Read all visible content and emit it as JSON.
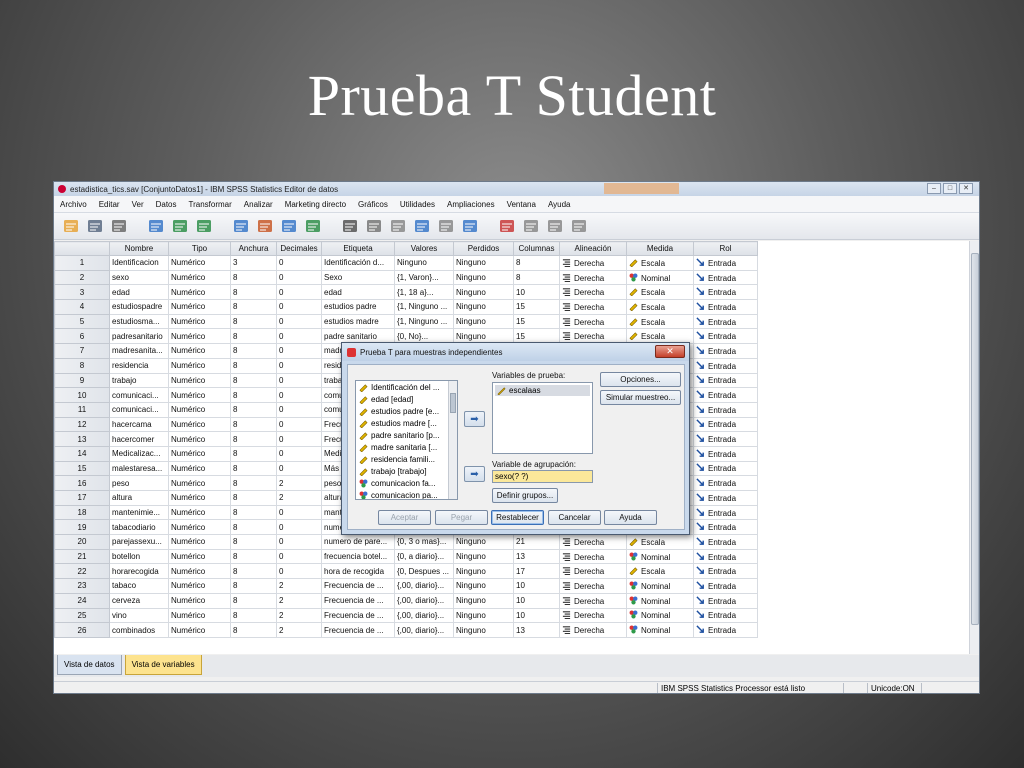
{
  "slide": {
    "title": "Prueba T Student"
  },
  "window": {
    "title": "estadistica_tics.sav [ConjuntoDatos1] - IBM SPSS Statistics Editor de datos",
    "controls": [
      "–",
      "□",
      "✕"
    ]
  },
  "menu": [
    "Archivo",
    "Editar",
    "Ver",
    "Datos",
    "Transformar",
    "Analizar",
    "Marketing directo",
    "Gráficos",
    "Utilidades",
    "Ampliaciones",
    "Ventana",
    "Ayuda"
  ],
  "toolbar_icons": [
    "open-icon",
    "save-icon",
    "print-icon",
    "dialog-recall-icon",
    "undo-icon",
    "redo-icon",
    "goto-case-icon",
    "goto-variable-icon",
    "variables-icon",
    "run-descriptives-icon",
    "find-icon",
    "insert-cases-icon",
    "insert-variable-icon",
    "split-file-icon",
    "weight-cases-icon",
    "select-cases-icon",
    "value-labels-icon",
    "use-sets-icon",
    "show-sets-icon",
    "spell-check-icon"
  ],
  "grid": {
    "columns": [
      "",
      "Nombre",
      "Tipo",
      "Anchura",
      "Decimales",
      "Etiqueta",
      "Valores",
      "Perdidos",
      "Columnas",
      "Alineación",
      "Medida",
      "Rol"
    ],
    "rows": [
      [
        "1",
        "Identificacion",
        "Numérico",
        "3",
        "0",
        "Identificación d...",
        "Ninguno",
        "Ninguno",
        "8",
        "Derecha",
        "Escala",
        "Entrada"
      ],
      [
        "2",
        "sexo",
        "Numérico",
        "8",
        "0",
        "Sexo",
        "{1, Varon}...",
        "Ninguno",
        "8",
        "Derecha",
        "Nominal",
        "Entrada"
      ],
      [
        "3",
        "edad",
        "Numérico",
        "8",
        "0",
        "edad",
        "{1, 18 a}...",
        "Ninguno",
        "10",
        "Derecha",
        "Escala",
        "Entrada"
      ],
      [
        "4",
        "estudiospadre",
        "Numérico",
        "8",
        "0",
        "estudios padre",
        "{1, Ninguno ...",
        "Ninguno",
        "15",
        "Derecha",
        "Escala",
        "Entrada"
      ],
      [
        "5",
        "estudiosma...",
        "Numérico",
        "8",
        "0",
        "estudios madre",
        "{1, Ninguno ...",
        "Ninguno",
        "15",
        "Derecha",
        "Escala",
        "Entrada"
      ],
      [
        "6",
        "padresanitario",
        "Numérico",
        "8",
        "0",
        "padre sanitario",
        "{0, No}...",
        "Ninguno",
        "15",
        "Derecha",
        "Escala",
        "Entrada"
      ],
      [
        "7",
        "madresanita...",
        "Numérico",
        "8",
        "0",
        "madr",
        "",
        "",
        "",
        "",
        "",
        "Entrada"
      ],
      [
        "8",
        "residencia",
        "Numérico",
        "8",
        "0",
        "resid",
        "",
        "",
        "",
        "",
        "",
        "Entrada"
      ],
      [
        "9",
        "trabajo",
        "Numérico",
        "8",
        "0",
        "traba",
        "",
        "",
        "",
        "",
        "",
        "Entrada"
      ],
      [
        "10",
        "comunicaci...",
        "Numérico",
        "8",
        "0",
        "comu",
        "",
        "",
        "",
        "",
        "",
        "Entrada"
      ],
      [
        "11",
        "comunicaci...",
        "Numérico",
        "8",
        "0",
        "comu",
        "",
        "",
        "",
        "",
        "",
        "Entrada"
      ],
      [
        "12",
        "hacercama",
        "Numérico",
        "8",
        "0",
        "Frecu",
        "",
        "",
        "",
        "",
        "",
        "Entrada"
      ],
      [
        "13",
        "hacercomer",
        "Numérico",
        "8",
        "0",
        "Frecu",
        "",
        "",
        "",
        "",
        "",
        "Entrada"
      ],
      [
        "14",
        "Medicalizac...",
        "Numérico",
        "8",
        "0",
        "Medic",
        "",
        "",
        "",
        "",
        "",
        "Entrada"
      ],
      [
        "15",
        "malestaresa...",
        "Numérico",
        "8",
        "0",
        "Más",
        "",
        "",
        "",
        "",
        "",
        "Entrada"
      ],
      [
        "16",
        "peso",
        "Numérico",
        "8",
        "2",
        "peso",
        "",
        "",
        "",
        "",
        "",
        "Entrada"
      ],
      [
        "17",
        "altura",
        "Numérico",
        "8",
        "2",
        "altura",
        "",
        "",
        "",
        "",
        "",
        "Entrada"
      ],
      [
        "18",
        "mantenimie...",
        "Numérico",
        "8",
        "0",
        "mant",
        "",
        "",
        "",
        "",
        "",
        "Entrada"
      ],
      [
        "19",
        "tabacodiario",
        "Numérico",
        "8",
        "0",
        "nume",
        "",
        "",
        "",
        "",
        "",
        "Entrada"
      ],
      [
        "20",
        "parejassexu...",
        "Numérico",
        "8",
        "0",
        "numero de pare...",
        "{0, 3 o mas}...",
        "Ninguno",
        "21",
        "Derecha",
        "Escala",
        "Entrada"
      ],
      [
        "21",
        "botellon",
        "Numérico",
        "8",
        "0",
        "frecuencia botel...",
        "{0, a diario}...",
        "Ninguno",
        "13",
        "Derecha",
        "Nominal",
        "Entrada"
      ],
      [
        "22",
        "horarecogida",
        "Numérico",
        "8",
        "0",
        "hora de recogida",
        "{0, Despues ...",
        "Ninguno",
        "17",
        "Derecha",
        "Escala",
        "Entrada"
      ],
      [
        "23",
        "tabaco",
        "Numérico",
        "8",
        "2",
        "Frecuencia de ...",
        "{,00, diario}...",
        "Ninguno",
        "10",
        "Derecha",
        "Nominal",
        "Entrada"
      ],
      [
        "24",
        "cerveza",
        "Numérico",
        "8",
        "2",
        "Frecuencia de ...",
        "{,00, diario}...",
        "Ninguno",
        "10",
        "Derecha",
        "Nominal",
        "Entrada"
      ],
      [
        "25",
        "vino",
        "Numérico",
        "8",
        "2",
        "Frecuencia de ...",
        "{,00, diario}...",
        "Ninguno",
        "10",
        "Derecha",
        "Nominal",
        "Entrada"
      ],
      [
        "26",
        "combinados",
        "Numérico",
        "8",
        "2",
        "Frecuencia de ...",
        "{,00, diario}...",
        "Ninguno",
        "13",
        "Derecha",
        "Nominal",
        "Entrada"
      ]
    ]
  },
  "tabs": [
    "Vista de datos",
    "Vista de variables"
  ],
  "status": {
    "processor": "IBM SPSS Statistics Processor está listo",
    "unicode": "Unicode:ON"
  },
  "dialog": {
    "title": "Prueba T para muestras independientes",
    "source_vars": [
      "Identificación del ...",
      "edad [edad]",
      "estudios padre [e...",
      "estudios madre [...",
      "padre sanitario [p...",
      "madre sanitaria [...",
      "residencia famili...",
      "trabajo [trabajo]",
      "comunicacion fa...",
      "comunicacion pa..."
    ],
    "test_label": "Variables de prueba:",
    "test_vars": [
      "escalaas"
    ],
    "group_label": "Variable de agrupación:",
    "group_value": "sexo(? ?)",
    "define_groups": "Definir grupos...",
    "options": "Opciones...",
    "bootstrap": "Simular muestreo...",
    "buttons": [
      "Aceptar",
      "Pegar",
      "Restablecer",
      "Cancelar",
      "Ayuda"
    ]
  }
}
